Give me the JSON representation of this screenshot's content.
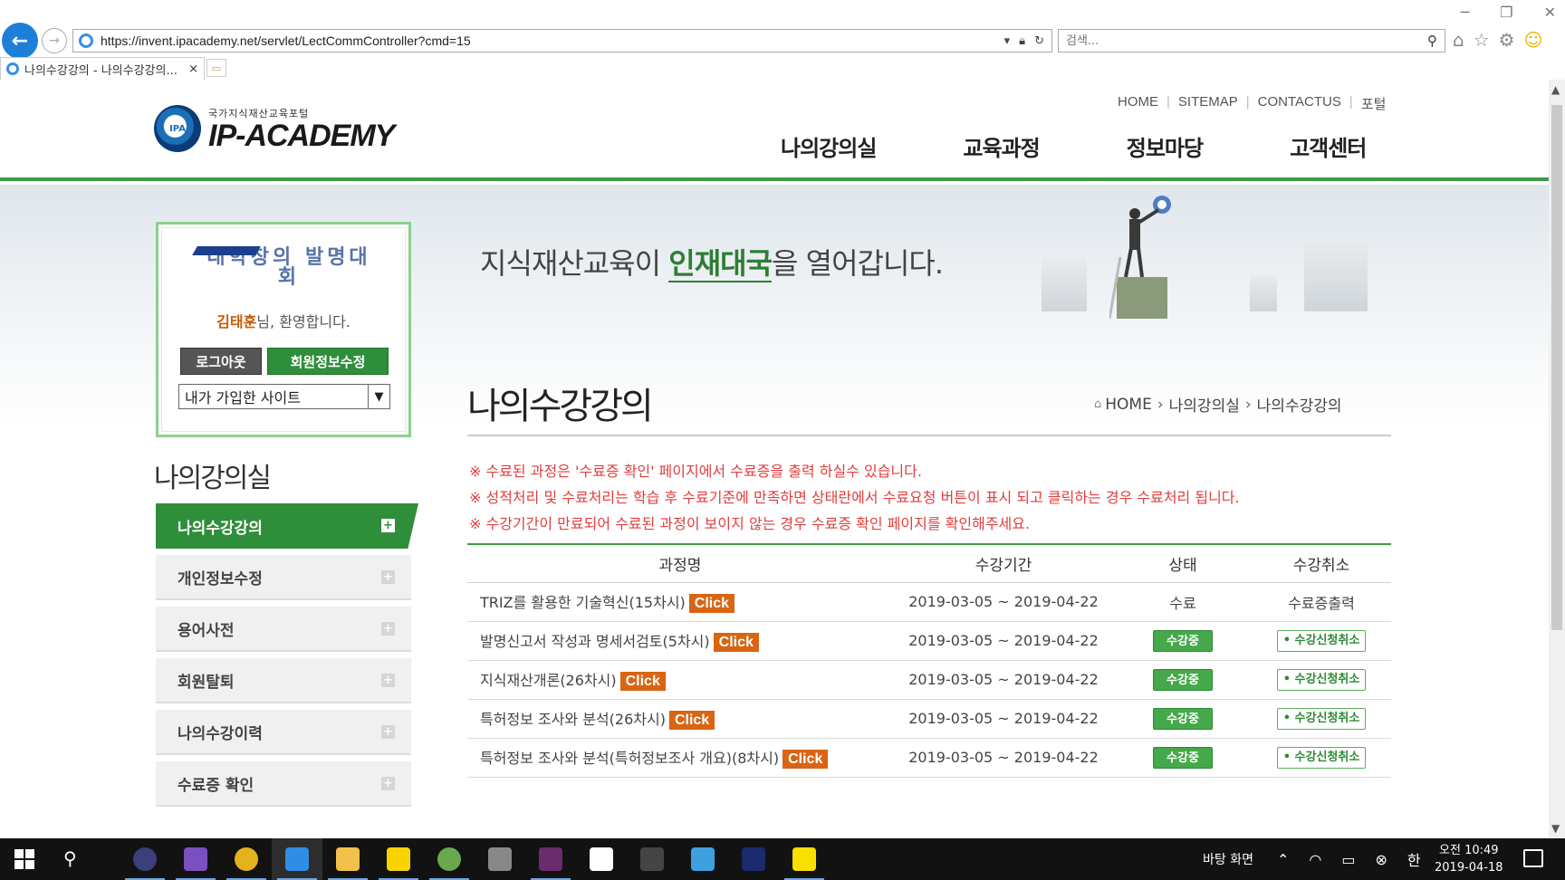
{
  "browser": {
    "url": "https://invent.ipacademy.net/servlet/LectCommController?cmd=15",
    "search_placeholder": "검색...",
    "tab_title": "나의수강강의 - 나의수강강의...",
    "tab_close": "×"
  },
  "header": {
    "logo_sub": "국가지식재산교육포털",
    "logo_main": "IP-ACADEMY",
    "logo_mark": "IPA",
    "util_links": [
      "HOME",
      "SITEMAP",
      "CONTACTUS",
      "포털"
    ],
    "gnb": [
      "나의강의실",
      "교육과정",
      "정보마당",
      "고객센터"
    ]
  },
  "banner": {
    "text_before": "지식재산교육이 ",
    "text_highlight": "인재대국",
    "text_after": "을 열어갑니다."
  },
  "login_box": {
    "event_logo": "대학창의 발명대회",
    "user_name": "김태훈",
    "welcome_suffix": "님, 환영합니다.",
    "logout_label": "로그아웃",
    "edit_info_label": "회원정보수정",
    "site_select_value": "내가 가입한 사이트"
  },
  "sidebar": {
    "title": "나의강의실",
    "items": [
      {
        "label": "나의수강강의",
        "active": true
      },
      {
        "label": "개인정보수정",
        "active": false
      },
      {
        "label": "용어사전",
        "active": false
      },
      {
        "label": "회원탈퇴",
        "active": false
      },
      {
        "label": "나의수강이력",
        "active": false
      },
      {
        "label": "수료증 확인",
        "active": false
      }
    ]
  },
  "content": {
    "page_title": "나의수강강의",
    "breadcrumb": [
      "HOME",
      "나의강의실",
      "나의수강강의"
    ],
    "notices": [
      "※ 수료된 과정은 '수료증 확인' 페이지에서 수료증을 출력 하실수 있습니다.",
      "※ 성적처리 및 수료처리는 학습 후 수료기준에 만족하면 상태란에서 수료요청 버튼이 표시 되고 클릭하는 경우 수료처리 됩니다.",
      "※ 수강기간이 만료되어 수료된 과정이 보이지 않는 경우 수료증 확인 페이지를 확인해주세요."
    ],
    "table": {
      "headers": [
        "과정명",
        "수강기간",
        "상태",
        "수강취소"
      ],
      "click_label": "Click",
      "rows": [
        {
          "name": "TRIZ를 활용한 기술혁신(15차시)",
          "period": "2019-03-05 ~ 2019-04-22",
          "status": "수료",
          "status_type": "text",
          "cancel": "수료증출력",
          "cancel_type": "text"
        },
        {
          "name": "발명신고서 작성과 명세서검토(5차시)",
          "period": "2019-03-05 ~ 2019-04-22",
          "status": "수강중",
          "status_type": "button",
          "cancel": "• 수강신청취소",
          "cancel_type": "button"
        },
        {
          "name": "지식재산개론(26차시)",
          "period": "2019-03-05 ~ 2019-04-22",
          "status": "수강중",
          "status_type": "button",
          "cancel": "• 수강신청취소",
          "cancel_type": "button"
        },
        {
          "name": "특허정보 조사와 분석(26차시)",
          "period": "2019-03-05 ~ 2019-04-22",
          "status": "수강중",
          "status_type": "button",
          "cancel": "• 수강신청취소",
          "cancel_type": "button"
        },
        {
          "name": "특허정보 조사와 분석(특허정보조사 개요)(8차시)",
          "period": "2019-03-05 ~ 2019-04-22",
          "status": "수강중",
          "status_type": "button",
          "cancel": "• 수강신청취소",
          "cancel_type": "button"
        }
      ]
    }
  },
  "taskbar": {
    "desktop_label": "바탕 화면",
    "ime": "한",
    "time": "오전 10:49",
    "date": "2019-04-18",
    "apps": [
      {
        "name": "eclipse-icon",
        "color": "#3b3f7a"
      },
      {
        "name": "visual-studio-icon",
        "color": "#7b4fbf"
      },
      {
        "name": "chrome-icon",
        "color": "#e4b21c"
      },
      {
        "name": "internet-explorer-icon",
        "color": "#2f8de4"
      },
      {
        "name": "file-explorer-icon",
        "color": "#f2c14b"
      },
      {
        "name": "sticky-notes-icon",
        "color": "#f7d300"
      },
      {
        "name": "android-studio-icon",
        "color": "#6aa84f"
      },
      {
        "name": "terminal-app-icon",
        "color": "#888888"
      },
      {
        "name": "slack-icon",
        "color": "#6b2c6e"
      },
      {
        "name": "vs-code-icon",
        "color": "#ffffff"
      },
      {
        "name": "visual-studio-alt-icon",
        "color": "#444444"
      },
      {
        "name": "network-app-icon",
        "color": "#3fa0e0"
      },
      {
        "name": "photo-app-icon",
        "color": "#1a2a6c"
      },
      {
        "name": "kakaotalk-icon",
        "color": "#f9e000"
      }
    ]
  }
}
